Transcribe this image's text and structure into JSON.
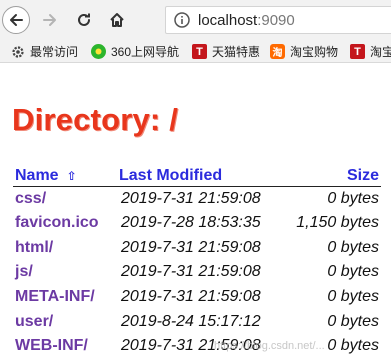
{
  "browser": {
    "url_host": "localhost",
    "url_port": ":9090"
  },
  "bookmarks": [
    {
      "label": "最常访问",
      "icon": "gear-icon"
    },
    {
      "label": "360上网导航",
      "icon": "360-nav-icon"
    },
    {
      "label": "天猫特惠",
      "icon": "tmall-icon",
      "badge": "T"
    },
    {
      "label": "淘宝购物",
      "icon": "taobao-icon",
      "badge": "淘"
    },
    {
      "label": "淘宝",
      "icon": "tmall-icon",
      "badge": "T"
    }
  ],
  "page": {
    "title": "Directory: /",
    "headers": {
      "name": "Name",
      "sort_arrow": "⇧",
      "modified": "Last Modified",
      "size": "Size"
    },
    "rows": [
      {
        "name": "css/",
        "modified": "2019-7-31 21:59:08",
        "size": "0 bytes"
      },
      {
        "name": "favicon.ico",
        "modified": "2019-7-28 18:53:35",
        "size": "1,150 bytes"
      },
      {
        "name": "html/",
        "modified": "2019-7-31 21:59:08",
        "size": "0 bytes"
      },
      {
        "name": "js/",
        "modified": "2019-7-31 21:59:08",
        "size": "0 bytes"
      },
      {
        "name": "META-INF/",
        "modified": "2019-7-31 21:59:08",
        "size": "0 bytes"
      },
      {
        "name": "user/",
        "modified": "2019-8-24 15:17:12",
        "size": "0 bytes"
      },
      {
        "name": "WEB-INF/",
        "modified": "2019-7-31 21:59:08",
        "size": "0 bytes"
      }
    ]
  },
  "watermark": "https://blog.csdn.net/..."
}
